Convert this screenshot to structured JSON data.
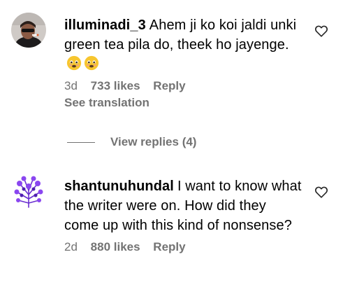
{
  "comments": [
    {
      "username": "illuminadi_3",
      "text": "Ahem ji ko koi jaldi unki green tea pila do, theek ho jayenge.",
      "emojis": [
        "disappointed-relieved-emoji",
        "disappointed-relieved-emoji"
      ],
      "time": "3d",
      "likes": "733 likes",
      "reply_label": "Reply",
      "translation_label": "See translation",
      "view_replies_label": "View replies (4)"
    },
    {
      "username": "shantunuhundal",
      "text": "I want to know what the writer were on. How did they come up with this kind of nonsense?",
      "time": "2d",
      "likes": "880 likes",
      "reply_label": "Reply"
    }
  ],
  "colors": {
    "text": "#000000",
    "secondary": "#737373"
  },
  "icons": {
    "like": "heart-outline-icon"
  }
}
